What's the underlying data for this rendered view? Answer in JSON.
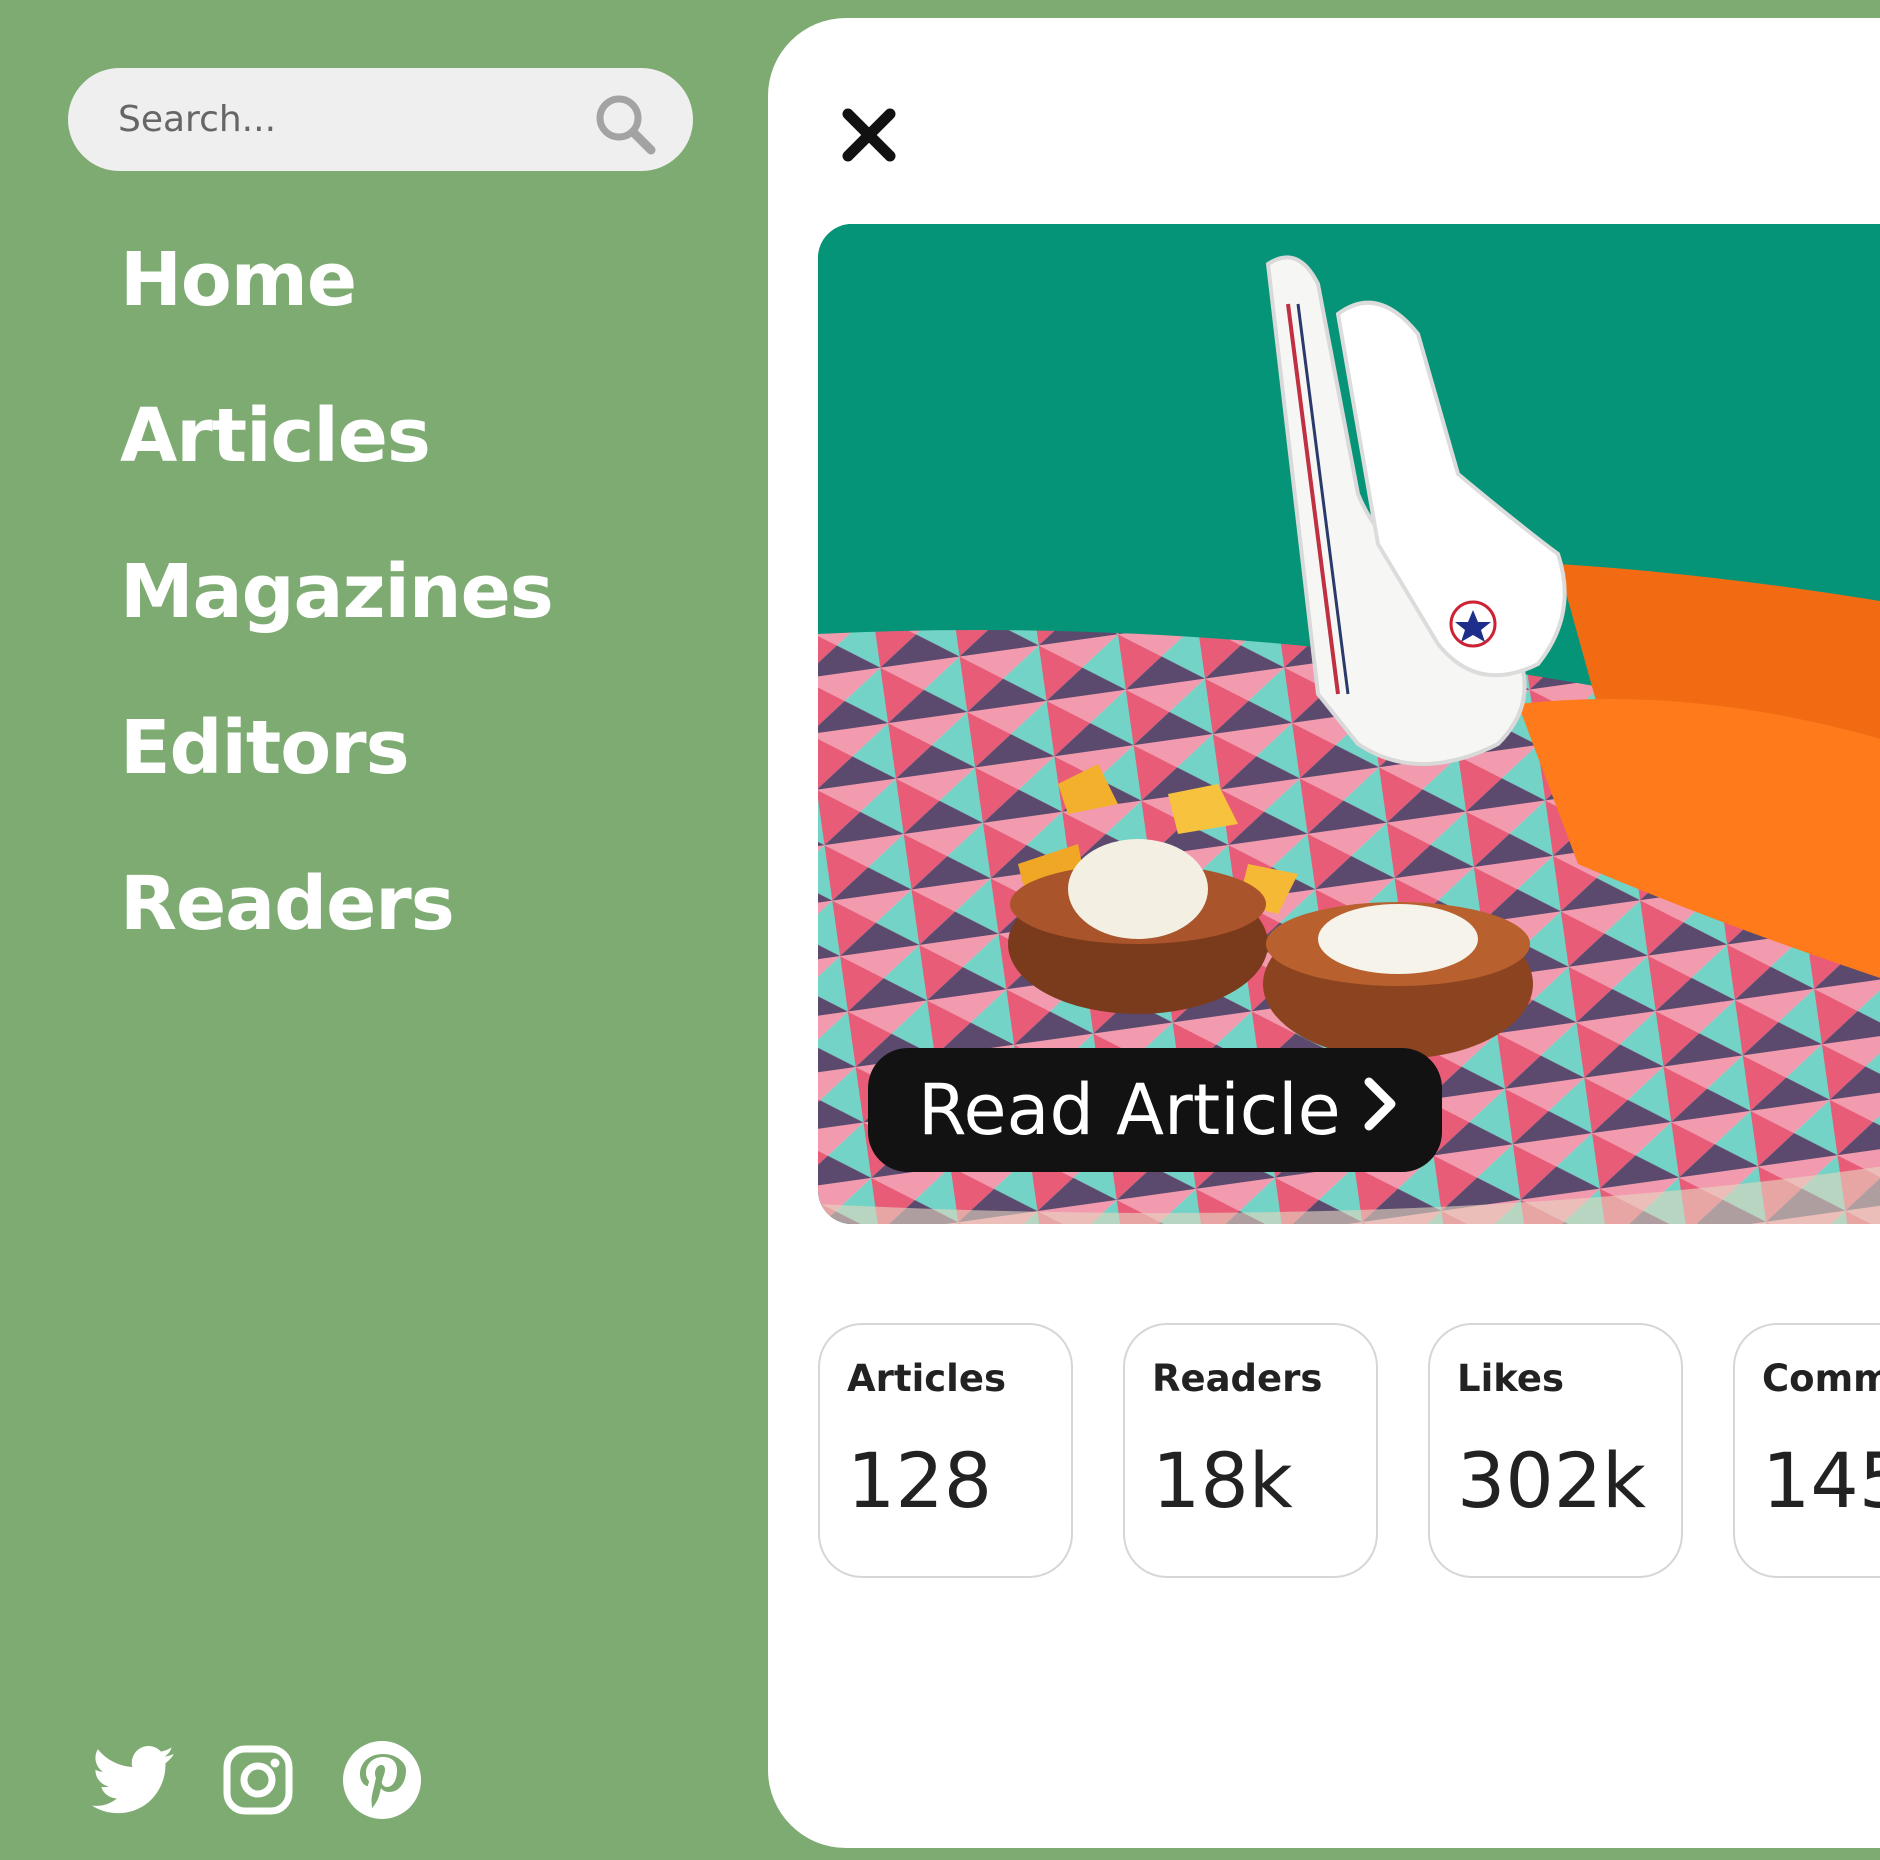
{
  "colors": {
    "background": "#7eab72",
    "panel": "#ffffff",
    "hero_bg": "#069478",
    "button": "#121212"
  },
  "search": {
    "placeholder": "Search...",
    "icon": "search-icon"
  },
  "nav": {
    "items": [
      {
        "label": "Home"
      },
      {
        "label": "Articles"
      },
      {
        "label": "Magazines"
      },
      {
        "label": "Editors"
      },
      {
        "label": "Readers"
      }
    ]
  },
  "social": [
    "twitter-icon",
    "instagram-icon",
    "pinterest-icon"
  ],
  "main": {
    "close_icon": "close-icon",
    "hero": {
      "button_label": "Read Article",
      "button_icon": "chevron-right-icon"
    },
    "stats": [
      {
        "label": "Articles",
        "value": "128"
      },
      {
        "label": "Readers",
        "value": "18k"
      },
      {
        "label": "Likes",
        "value": "302k"
      },
      {
        "label": "Comm",
        "value": "145"
      }
    ]
  }
}
